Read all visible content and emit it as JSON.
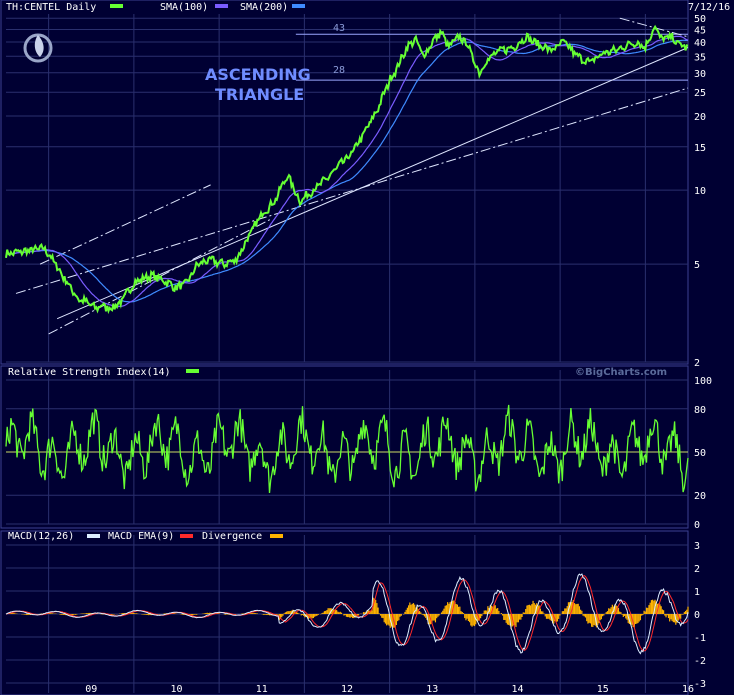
{
  "header": {
    "symbol_label": "TH:CENTEL Daily",
    "sma100_label": "SMA(100)",
    "sma200_label": "SMA(200)",
    "date": "7/12/16"
  },
  "annotations": {
    "pattern_line1": "ASCENDING",
    "pattern_line2": "TRIANGLE",
    "resistance_label": "43",
    "support_label": "28",
    "watermark": "©BigCharts.com"
  },
  "colors": {
    "background": "#000033",
    "price": "#66ff33",
    "sma100": "#7a5cff",
    "sma200": "#3f8bff",
    "grid": "#2a2f6e",
    "macd": "#ddeeff",
    "macd_ema": "#ff2a2a",
    "divergence": "#ffb300",
    "annotation": "#6f8cff"
  },
  "chart_data": [
    {
      "type": "line",
      "title": "TH:CENTEL Daily",
      "log_scale": true,
      "ylim": [
        2,
        52
      ],
      "yticks": [
        2,
        5,
        10,
        15,
        20,
        25,
        30,
        35,
        40,
        45,
        50
      ],
      "x_ticks": [
        "09",
        "10",
        "11",
        "12",
        "13",
        "14",
        "15",
        "16"
      ],
      "price_anchors": {
        "x": [
          2008.5,
          2008.8,
          2008.95,
          2009.05,
          2009.2,
          2009.35,
          2009.45,
          2009.55,
          2009.62,
          2009.72,
          2009.85,
          2010.0,
          2010.2,
          2010.35,
          2010.5,
          2010.62,
          2010.75,
          2010.9,
          2011.05,
          2011.2,
          2011.35,
          2011.5,
          2011.65,
          2011.8,
          2011.95,
          2012.1,
          2012.25,
          2012.4,
          2012.55,
          2012.7,
          2012.85,
          2013.0,
          2013.1,
          2013.2,
          2013.3,
          2013.4,
          2013.5,
          2013.6,
          2013.7,
          2013.8,
          2013.9,
          2014.0,
          2014.05,
          2014.15,
          2014.3,
          2014.45,
          2014.6,
          2014.75,
          2014.9,
          2015.05,
          2015.2,
          2015.35,
          2015.5,
          2015.65,
          2015.8,
          2015.9,
          2016.0,
          2016.1,
          2016.2,
          2016.3,
          2016.4,
          2016.5
        ],
        "y": [
          5.5,
          5.7,
          5.8,
          5.2,
          4.3,
          3.6,
          3.5,
          3.3,
          3.4,
          3.3,
          3.5,
          4.2,
          4.5,
          4.3,
          4.0,
          4.2,
          5.0,
          5.2,
          5.0,
          5.2,
          6.5,
          8.0,
          9.0,
          11.5,
          9.0,
          10.0,
          11.0,
          12.5,
          14.0,
          17.0,
          21.0,
          28.0,
          32.0,
          38.0,
          41.0,
          35.0,
          40.0,
          44.0,
          38.0,
          42.0,
          40.0,
          33.0,
          30.0,
          34.0,
          37.0,
          38.0,
          42.0,
          39.0,
          37.0,
          40.0,
          35.0,
          33.0,
          36.0,
          37.0,
          39.0,
          40.0,
          38.0,
          46.0,
          41.0,
          42.0,
          39.0,
          38.0
        ]
      },
      "levels": [
        {
          "label": "43",
          "value": 43
        },
        {
          "label": "28",
          "value": 28
        }
      ]
    },
    {
      "type": "line",
      "title": "Relative Strength Index(14)",
      "ylim": [
        0,
        100
      ],
      "yticks": [
        0,
        20,
        50,
        80,
        100
      ],
      "reference_line": 50
    },
    {
      "type": "line",
      "title": "MACD(12,26)",
      "series": [
        {
          "name": "MACD(12,26)"
        },
        {
          "name": "MACD EMA(9)"
        },
        {
          "name": "Divergence"
        }
      ],
      "ylim": [
        -3,
        3
      ],
      "yticks": [
        -3,
        -2,
        -1,
        0,
        1,
        2,
        3
      ]
    }
  ]
}
